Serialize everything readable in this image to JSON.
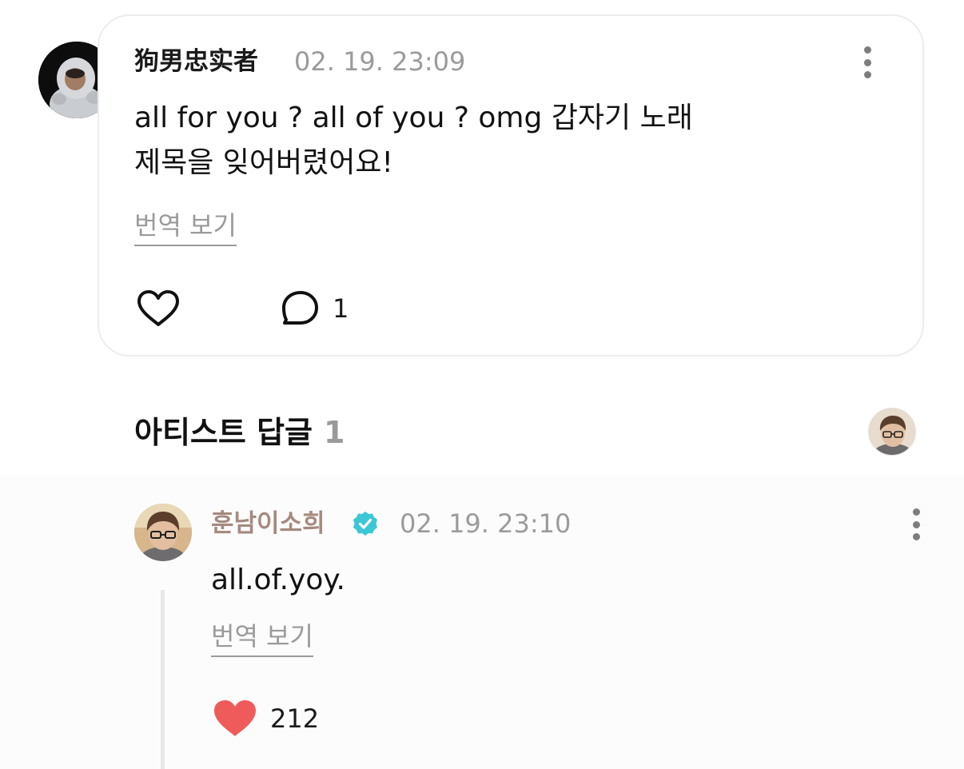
{
  "comment": {
    "author": "狗男忠实者",
    "timestamp": "02. 19. 23:09",
    "text_line1": "all for you ? all of you ? omg 갑자기 노래",
    "text_line2": "제목을 잊어버렸어요!",
    "translate_label": "번역 보기",
    "reply_count": "1"
  },
  "artist_replies": {
    "title": "아티스트 답글",
    "count": "1"
  },
  "reply": {
    "author": "훈남이소희",
    "timestamp": "02. 19. 23:10",
    "text": "all.of.yoy.",
    "translate_label": "번역 보기",
    "like_count": "212"
  },
  "colors": {
    "like_heart": "#ef5b5b",
    "verified_badge": "#3cc7d4",
    "artist_name": "#a58a7f"
  },
  "icons": {
    "like": "heart-outline-icon",
    "reply": "speech-bubble-icon",
    "more": "more-vertical-icon",
    "verified": "verified-badge-icon",
    "liked": "heart-filled-icon"
  }
}
